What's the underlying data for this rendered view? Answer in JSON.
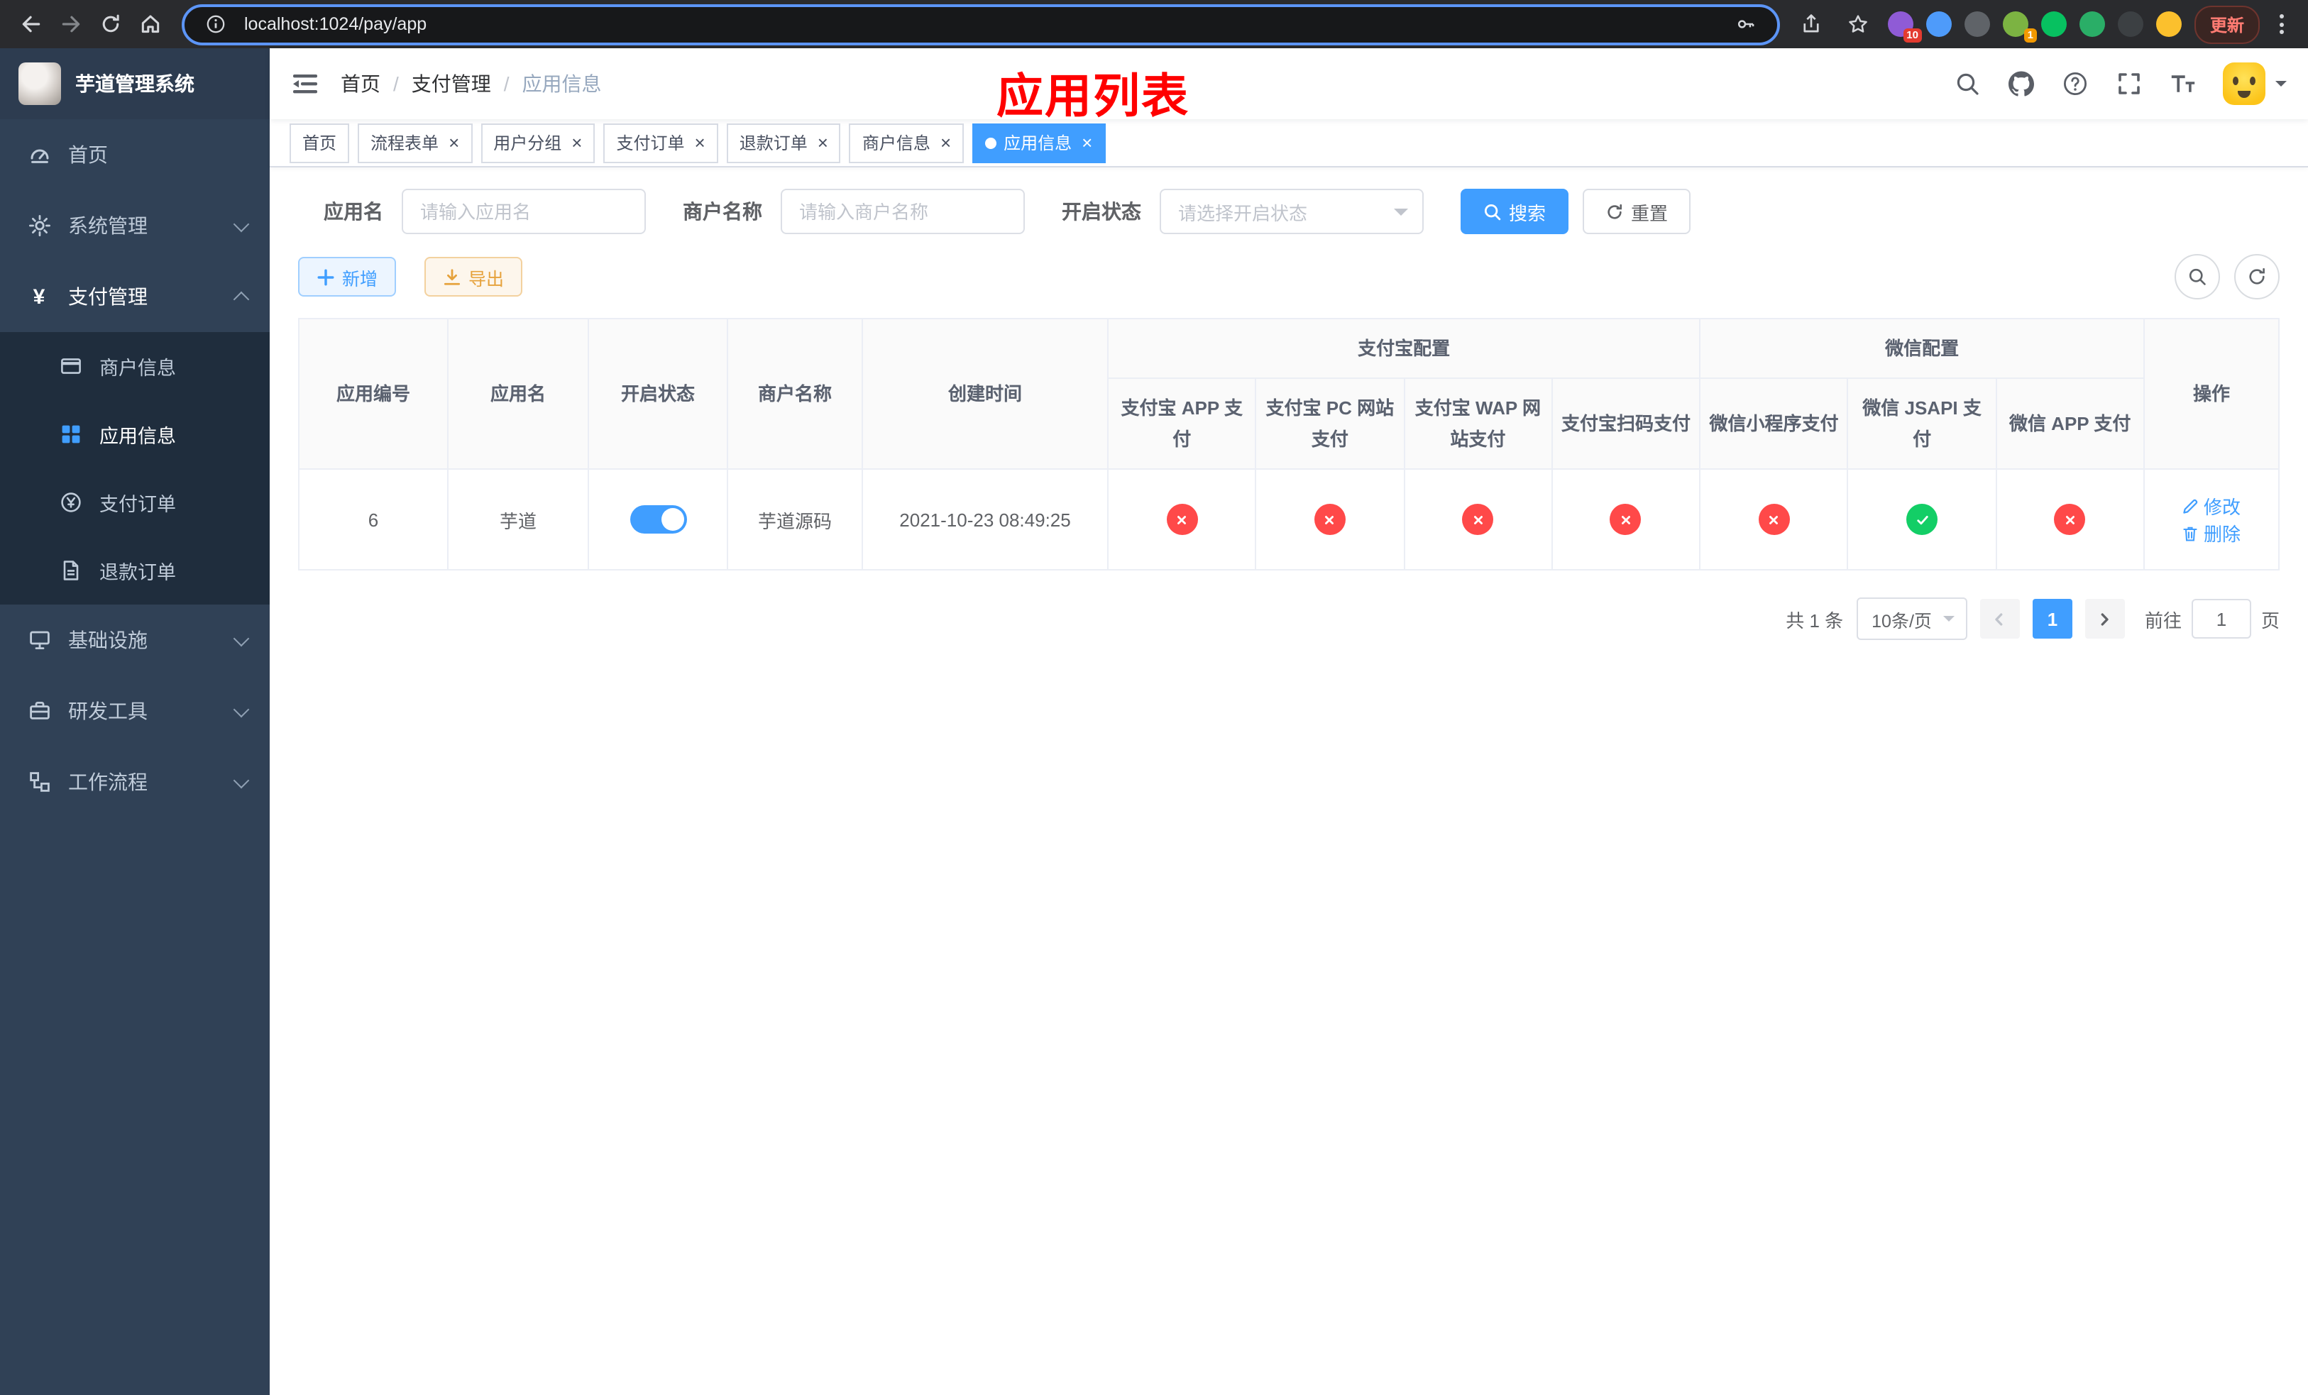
{
  "browser": {
    "url": "localhost:1024/pay/app",
    "update_label": "更新",
    "extensions": [
      {
        "name": "colorful-extension-icon",
        "color": "#8f5bd6",
        "badge": "10",
        "badge_color": "#e33b30"
      },
      {
        "name": "blue-drop-extension-icon",
        "color": "#4e9bfa"
      },
      {
        "name": "dark-globe-extension-icon",
        "color": "#5f6368"
      },
      {
        "name": "avatar-extension-icon",
        "color": "#7cb342",
        "badge": "1",
        "badge_color": "#f29900"
      },
      {
        "name": "wechat-devtools-extension-icon",
        "color": "#07c160"
      },
      {
        "name": "green-chat-extension-icon",
        "color": "#2aae67"
      },
      {
        "name": "dark-knot-extension-icon",
        "color": "#3c4043"
      },
      {
        "name": "emoji-face-extension-icon",
        "color": "#fbc02d"
      }
    ]
  },
  "app": {
    "logo_title": "芋道管理系统"
  },
  "sidebar": {
    "items": [
      {
        "label": "首页",
        "icon": "dashboard-icon",
        "type": "top"
      },
      {
        "label": "系统管理",
        "icon": "gear-icon",
        "type": "top",
        "arrow": true
      },
      {
        "label": "支付管理",
        "icon": "yen-icon",
        "type": "top",
        "arrow": true,
        "open": true,
        "active": true
      },
      {
        "label": "商户信息",
        "icon": "card-icon",
        "type": "sub"
      },
      {
        "label": "应用信息",
        "icon": "grid-icon",
        "type": "sub",
        "active": true
      },
      {
        "label": "支付订单",
        "icon": "coin-icon",
        "type": "sub"
      },
      {
        "label": "退款订单",
        "icon": "doc-icon",
        "type": "sub"
      },
      {
        "label": "基础设施",
        "icon": "infra-icon",
        "type": "top",
        "arrow": true
      },
      {
        "label": "研发工具",
        "icon": "toolbox-icon",
        "type": "top",
        "arrow": true
      },
      {
        "label": "工作流程",
        "icon": "workflow-icon",
        "type": "top",
        "arrow": true
      }
    ]
  },
  "navbar": {
    "breadcrumb": [
      "首页",
      "支付管理",
      "应用信息"
    ],
    "annotation": "应用列表"
  },
  "tabs": [
    {
      "label": "首页",
      "closable": false,
      "active": false
    },
    {
      "label": "流程表单",
      "closable": true,
      "active": false
    },
    {
      "label": "用户分组",
      "closable": true,
      "active": false
    },
    {
      "label": "支付订单",
      "closable": true,
      "active": false
    },
    {
      "label": "退款订单",
      "closable": true,
      "active": false
    },
    {
      "label": "商户信息",
      "closable": true,
      "active": false
    },
    {
      "label": "应用信息",
      "closable": true,
      "active": true
    }
  ],
  "filters": {
    "fields": [
      {
        "label": "应用名",
        "placeholder": "请输入应用名",
        "type": "input"
      },
      {
        "label": "商户名称",
        "placeholder": "请输入商户名称",
        "type": "input"
      },
      {
        "label": "开启状态",
        "placeholder": "请选择开启状态",
        "type": "select"
      }
    ],
    "search_label": "搜索",
    "reset_label": "重置"
  },
  "toolbar": {
    "add_label": "新增",
    "export_label": "导出"
  },
  "table": {
    "headers": {
      "app_id": "应用编号",
      "app_name": "应用名",
      "status": "开启状态",
      "merchant": "商户名称",
      "created": "创建时间",
      "alipay_group": "支付宝配置",
      "wechat_group": "微信配置",
      "alipay_app": "支付宝 APP 支付",
      "alipay_pc": "支付宝 PC 网站支付",
      "alipay_wap": "支付宝 WAP 网站支付",
      "alipay_qr": "支付宝扫码支付",
      "wx_mini": "微信小程序支付",
      "wx_jsapi": "微信 JSAPI 支付",
      "wx_app": "微信 APP 支付",
      "actions": "操作"
    },
    "rows": [
      {
        "app_id": "6",
        "app_name": "芋道",
        "enabled": true,
        "merchant": "芋道源码",
        "created": "2021-10-23 08:49:25",
        "statuses": {
          "alipay_app": false,
          "alipay_pc": false,
          "alipay_wap": false,
          "alipay_qr": false,
          "wx_mini": false,
          "wx_jsapi": true,
          "wx_app": false
        },
        "edit_label": "修改",
        "delete_label": "删除"
      }
    ]
  },
  "pagination": {
    "total": "共 1 条",
    "page_size": "10条/页",
    "page": "1",
    "goto_prefix": "前往",
    "goto_value": "1",
    "goto_suffix": "页"
  },
  "colors": {
    "primary": "#409eff",
    "success": "#13ce66",
    "danger": "#ff4949",
    "warning": "#e6a23c",
    "sidebar_bg": "#304156",
    "annotation_red": "#ff0000"
  }
}
